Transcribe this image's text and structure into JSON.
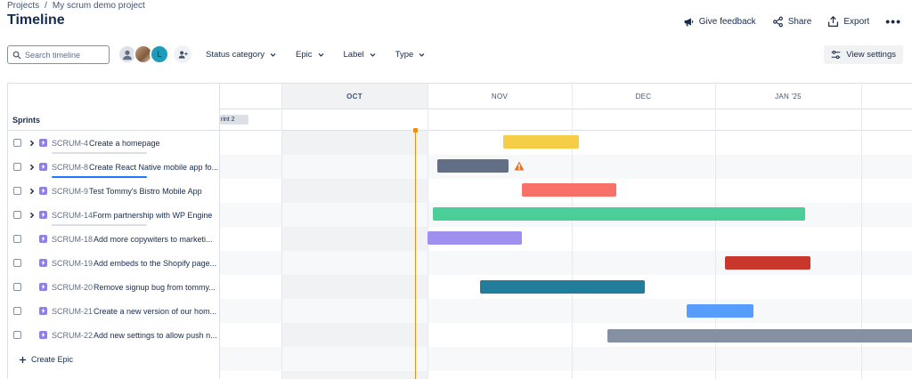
{
  "breadcrumb": {
    "projects": "Projects",
    "separator": "/",
    "project": "My scrum demo project"
  },
  "page_title": "Timeline",
  "top_actions": {
    "feedback": "Give feedback",
    "share": "Share",
    "export": "Export",
    "more": "•••"
  },
  "toolbar": {
    "search_placeholder": "Search timeline",
    "avatar_letter": "L",
    "filters": [
      "Status category",
      "Epic",
      "Label",
      "Type"
    ],
    "view_settings": "View settings"
  },
  "timeline": {
    "months": [
      "OCT",
      "NOV",
      "DEC",
      "JAN '25"
    ],
    "sprints_label": "Sprints",
    "sprint_chip": "rint 2",
    "today_color": "#f18d13"
  },
  "issues": [
    {
      "key": "SCRUM-4",
      "summary": "Create a homepage",
      "expandable": true,
      "progress": 0,
      "bar_color": "#f5cd47"
    },
    {
      "key": "SCRUM-8",
      "summary": "Create React Native mobile app fo...",
      "expandable": true,
      "progress": 1.0,
      "bar_color": "#626f86",
      "warning": true
    },
    {
      "key": "SCRUM-9",
      "summary": "Test Tommy's Bistro Mobile App",
      "expandable": true,
      "progress": 0,
      "bar_color": "#f87168"
    },
    {
      "key": "SCRUM-14",
      "summary": "Form partnership with WP Engine",
      "expandable": true,
      "progress": 0,
      "bar_color": "#4bce97"
    },
    {
      "key": "SCRUM-18",
      "summary": "Add more copywiters to marketi...",
      "expandable": false,
      "bar_color": "#9f8fef"
    },
    {
      "key": "SCRUM-19",
      "summary": "Add embeds to the Shopify page...",
      "expandable": false,
      "bar_color": "#c9372c"
    },
    {
      "key": "SCRUM-20",
      "summary": "Remove signup bug from tommy...",
      "expandable": false,
      "bar_color": "#227d9b"
    },
    {
      "key": "SCRUM-21",
      "summary": "Create a new version of our hom...",
      "expandable": false,
      "bar_color": "#579dff"
    },
    {
      "key": "SCRUM-22",
      "summary": "Add new settings to allow push n...",
      "expandable": false,
      "bar_color": "#8590a2"
    }
  ],
  "create_epic": "Create Epic"
}
